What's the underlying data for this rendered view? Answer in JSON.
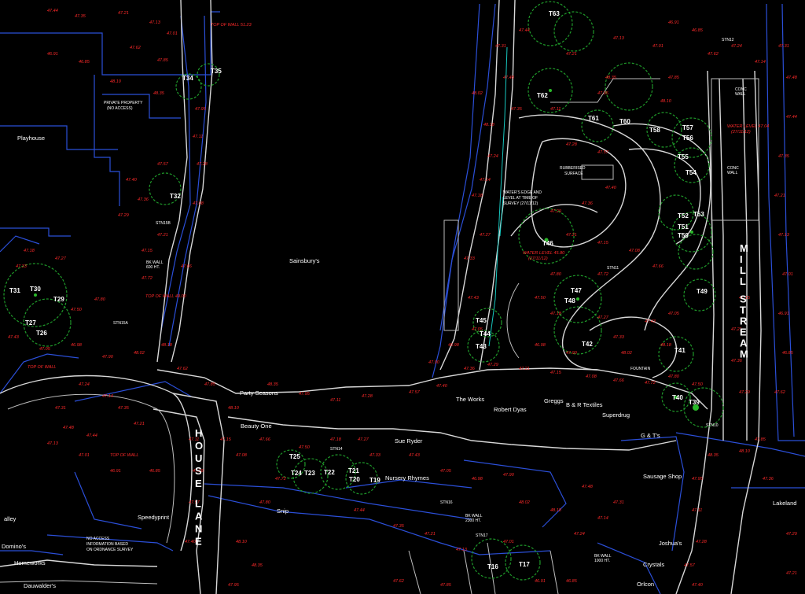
{
  "shops": [
    {
      "id": "playhouse",
      "text": "Playhouse"
    },
    {
      "id": "sainsburys",
      "text": "Sainsbury's"
    },
    {
      "id": "party-seasons",
      "text": "Party Seasons"
    },
    {
      "id": "beauty-one",
      "text": "Beauty One"
    },
    {
      "id": "sue-ryder",
      "text": "Sue Ryder"
    },
    {
      "id": "nursery-rhymes",
      "text": "Nursery Rhymes"
    },
    {
      "id": "the-works",
      "text": "The Works"
    },
    {
      "id": "robert-dyas",
      "text": "Robert Dyas"
    },
    {
      "id": "greggs",
      "text": "Greggs"
    },
    {
      "id": "br-textiles",
      "text": "B & R Textiles"
    },
    {
      "id": "superdrug",
      "text": "Superdrug"
    },
    {
      "id": "gts",
      "text": "G & T's"
    },
    {
      "id": "sausage-shop",
      "text": "Sausage Shop"
    },
    {
      "id": "lakeland",
      "text": "Lakeland"
    },
    {
      "id": "joshuas",
      "text": "Joshua's"
    },
    {
      "id": "crystals",
      "text": "Crystals"
    },
    {
      "id": "orlcon",
      "text": "Orlcon"
    },
    {
      "id": "speedyprint",
      "text": "Speedyprint"
    },
    {
      "id": "snip",
      "text": "Snip"
    },
    {
      "id": "dominos",
      "text": "Domino's"
    },
    {
      "id": "homeworks",
      "text": "Homeworks"
    },
    {
      "id": "dauwalders",
      "text": "Dauwalder's"
    },
    {
      "id": "alley",
      "text": "alley"
    }
  ],
  "notes": [
    {
      "id": "private-property",
      "lines": [
        "PRIVATE PROPERTY",
        "(NO ACCESS)"
      ]
    },
    {
      "id": "no-access",
      "lines": [
        "NO ACCESS",
        "INFORMATION BASED",
        "ON ORDNANCE SURVEY"
      ]
    },
    {
      "id": "rubberised",
      "lines": [
        "RUBBERISED",
        "SURFACE"
      ]
    },
    {
      "id": "waters-edge",
      "lines": [
        "WATER'S EDGE AND",
        "LEVEL AT TIME OF",
        "SURVEY (27/11/12)"
      ]
    },
    {
      "id": "water-level-1",
      "lines": [
        "WATER LEVEL 45.80",
        "(27/11/12)"
      ]
    },
    {
      "id": "water-level-2",
      "lines": [
        "WATER LEVEL 47.04",
        "(27/11/12)"
      ]
    },
    {
      "id": "conc-wall-1",
      "lines": [
        "CONC",
        "WALL"
      ]
    },
    {
      "id": "conc-wall-2",
      "lines": [
        "CONC",
        "WALL"
      ]
    },
    {
      "id": "bk-wall",
      "lines": [
        "BK WALL",
        "600 HT."
      ]
    },
    {
      "id": "bk-wall-2",
      "lines": [
        "BK WALL",
        "2300 HT."
      ]
    },
    {
      "id": "bk-wall-3",
      "lines": [
        "BK WALL",
        "1000 HT."
      ]
    },
    {
      "id": "fountain",
      "lines": [
        "FOUNTAIN"
      ]
    }
  ],
  "red_notes": [
    {
      "id": "top-wall-1",
      "text": "TOP OF WALL 51.23"
    },
    {
      "id": "top-wall-2",
      "text": "TOP OF WALL 49.00"
    },
    {
      "id": "top-wall-3",
      "text": "TOP OF WALL"
    },
    {
      "id": "top-wall-4",
      "text": "TOP OF WALL"
    }
  ],
  "street_names": {
    "mill_stream": "MILL STREAM",
    "house_lane": "HOUSE LANE"
  },
  "trees": [
    "T34",
    "T35",
    "T32",
    "T31",
    "T30",
    "T29",
    "T27",
    "T26",
    "T63",
    "T62",
    "T61",
    "T60",
    "T58",
    "T57",
    "T56",
    "T55",
    "T54",
    "T53",
    "T52",
    "T51",
    "T50",
    "T46",
    "T47",
    "T48",
    "T49",
    "T45",
    "T44",
    "T43",
    "T42",
    "T41",
    "T40",
    "T39",
    "T25",
    "T24",
    "T23",
    "T22",
    "T21",
    "T20",
    "T19",
    "T16",
    "T17"
  ],
  "levels": [
    "47.44",
    "47.35",
    "47.21",
    "47.13",
    "47.01",
    "46.91",
    "46.85",
    "47.62",
    "47.85",
    "48.10",
    "48.35",
    "47.95",
    "47.11",
    "47.28",
    "47.57",
    "47.40",
    "47.36",
    "47.29",
    "47.21",
    "47.15",
    "47.08",
    "47.66",
    "47.72",
    "47.80",
    "47.50",
    "47.18",
    "47.27",
    "47.33",
    "47.43",
    "47.05",
    "46.98",
    "47.90",
    "48.02",
    "48.18",
    "47.24",
    "47.14",
    "47.31",
    "47.48"
  ],
  "markers": {
    "stn": [
      "STN15B",
      "STN15A",
      "STN11",
      "STN12",
      "STN10",
      "STN14",
      "STN16",
      "STN17"
    ]
  },
  "colors": {
    "background": "#000000",
    "boundary": "#2b4fd8",
    "levels": "#ff2a2a",
    "trees": "#1f9a2a",
    "kerb": "#d8d8d8",
    "water": "#18c8c0"
  }
}
